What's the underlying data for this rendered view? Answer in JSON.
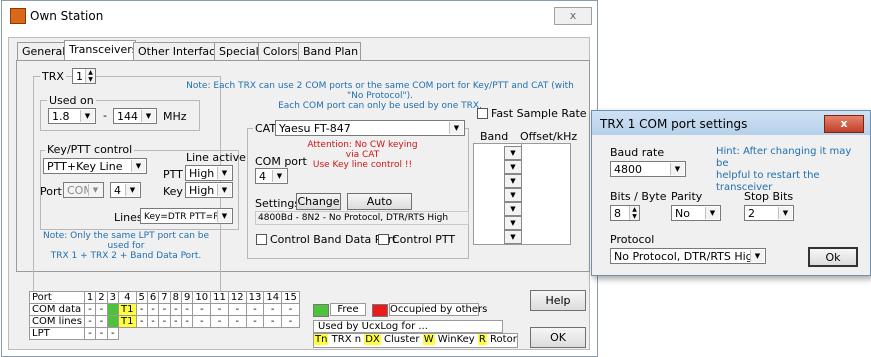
{
  "window": {
    "title": "Own Station",
    "close_label": "x"
  },
  "tabs": [
    "General",
    "Transceivers",
    "Other Interfaces",
    "Special",
    "Colors",
    "Band Plan"
  ],
  "trx": {
    "label": "TRX",
    "value": "1",
    "note": "Note: Each TRX can use 2 COM ports or the same COM port for Key/PTT and CAT (with \"No Protocol\").\nEach COM port can only be used by one TRX."
  },
  "used_on": {
    "label": "Used on",
    "from": "1.8",
    "to": "144",
    "unit": "MHz"
  },
  "keyptt": {
    "label": "Key/PTT control",
    "mode": "PTT+Key Line",
    "port_label": "Port",
    "port_type": "COM",
    "port_num": "4",
    "line_active_label": "Line active",
    "ptt_label": "PTT",
    "ptt_value": "High",
    "key_label": "Key",
    "key_value": "High",
    "lines_label": "Lines",
    "lines_value": "Key=DTR PTT=RTS",
    "note": "Note: Only the same LPT port can be used for\nTRX 1 + TRX 2 + Band Data Port."
  },
  "cat": {
    "label": "CAT",
    "radio": "Yaesu FT-847",
    "attention": "Attention: No CW keying via CAT\nUse Key line control !!",
    "com_port_label": "COM port",
    "com_port": "4",
    "settings_label": "Settings",
    "change_button": "Change",
    "auto_detect_button": "Auto Detect",
    "settings_value": "4800Bd - 8N2 - No Protocol, DTR/RTS High",
    "control_band_label": "Control Band Data Port",
    "control_ptt_label": "Control PTT"
  },
  "fast_sample": {
    "label": "Fast Sample Rate"
  },
  "band_table": {
    "col_band": "Band",
    "col_offset": "Offset/kHz",
    "rows": 7
  },
  "ports": {
    "header": [
      "Port",
      "1",
      "2",
      "3",
      "4",
      "5",
      "6",
      "7",
      "8",
      "9",
      "10",
      "11",
      "12",
      "13",
      "14",
      "15"
    ],
    "rows": [
      {
        "label": "COM data",
        "cells": [
          "-",
          "-",
          "",
          "T1",
          "-",
          "-",
          "-",
          "-",
          "-",
          "-",
          "-",
          "-",
          "-",
          "-",
          "-"
        ]
      },
      {
        "label": "COM lines",
        "cells": [
          "-",
          "-",
          "",
          "T1",
          "-",
          "-",
          "-",
          "-",
          "-",
          "-",
          "-",
          "-",
          "-",
          "-",
          "-"
        ]
      },
      {
        "label": "LPT",
        "cells": [
          "-",
          "-",
          "-"
        ]
      }
    ]
  },
  "legend": {
    "free": "Free",
    "occupied": "Occupied by others",
    "used_by": "Used by UcxLog for ...",
    "tn": "Tn",
    "trx_n": "TRX n",
    "dx": "DX",
    "cluster": "Cluster",
    "w": "W",
    "winkey": "WinKey",
    "r": "R",
    "rotor": "Rotor"
  },
  "buttons": {
    "help": "Help",
    "ok": "OK"
  },
  "colors": {
    "green": "#4fc13f",
    "red": "#e81c1c",
    "yellow": "#ffff40",
    "note_blue": "#1f6fb0"
  },
  "dialog": {
    "title": "TRX 1 COM port settings",
    "close_label": "x",
    "baud_label": "Baud rate",
    "baud": "4800",
    "hint": "Hint: After changing it may be\nhelpful to restart the transceiver",
    "bits_label": "Bits / Byte",
    "bits": "8",
    "parity_label": "Parity",
    "parity": "No",
    "stop_label": "Stop Bits",
    "stop": "2",
    "protocol_label": "Protocol",
    "protocol": "No Protocol, DTR/RTS High",
    "ok": "Ok"
  }
}
